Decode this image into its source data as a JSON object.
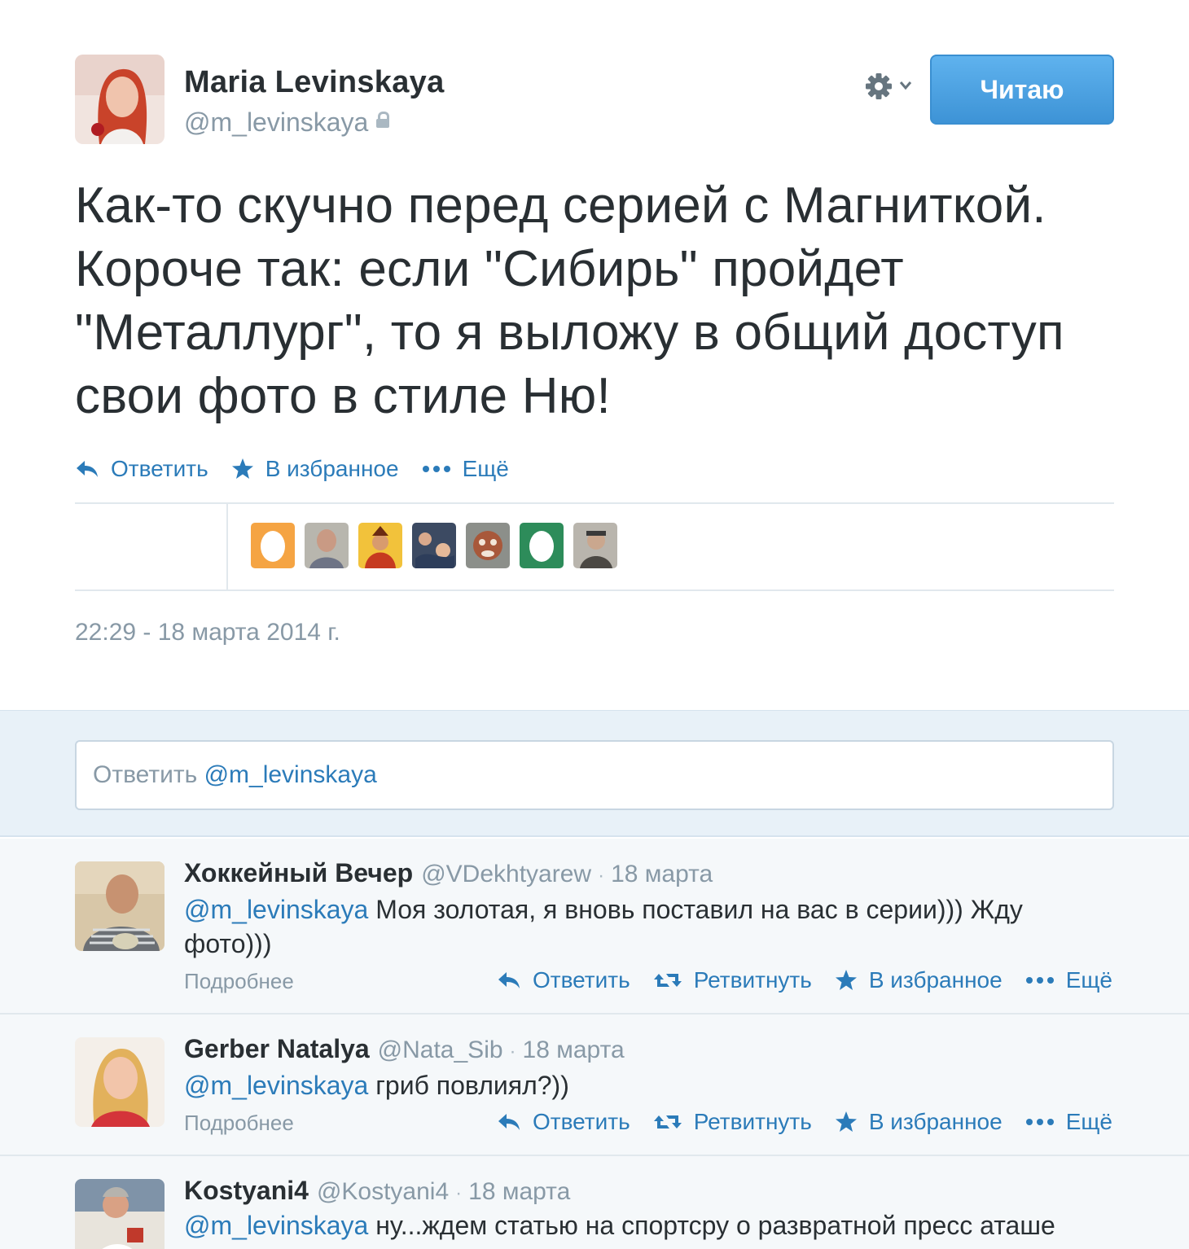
{
  "tweet": {
    "author_name": "Maria Levinskaya",
    "author_handle": "@m_levinskaya",
    "follow_label": "Читаю",
    "text": "Как-то скучно перед серией с Магниткой. Короче так: если \"Сибирь\" пройдет \"Металлург\", то я выложу в общий доступ свои фото в стиле Ню!",
    "actions": {
      "reply": "Ответить",
      "favorite": "В избранное",
      "more": "Ещё"
    },
    "timestamp": "22:29 - 18 марта 2014 г."
  },
  "reply_box": {
    "prefix": "Ответить",
    "mention": "@m_levinskaya"
  },
  "replies": [
    {
      "name": "Хоккейный Вечер",
      "handle": "@VDekhtyarew",
      "date": "18 марта",
      "mention": "@m_levinskaya",
      "text": " Моя золотая, я вновь поставил на вас в серии))) Жду фото)))",
      "details": "Подробнее",
      "actions": {
        "reply": "Ответить",
        "retweet": "Ретвитнуть",
        "favorite": "В избранное",
        "more": "Ещё"
      }
    },
    {
      "name": "Gerber Natalya",
      "handle": "@Nata_Sib",
      "date": "18 марта",
      "mention": "@m_levinskaya",
      "text": " гриб повлиял?))",
      "details": "Подробнее",
      "actions": {
        "reply": "Ответить",
        "retweet": "Ретвитнуть",
        "favorite": "В избранное",
        "more": "Ещё"
      }
    },
    {
      "name": "Kostyani4",
      "handle": "@Kostyani4",
      "date": "18 марта",
      "mention": "@m_levinskaya",
      "text": " ну...ждем статью на спортсру о развратной пресс аташе"
    }
  ],
  "colors": {
    "link": "#2b7bb9",
    "follow_button": "#4aa3e3",
    "reply_area_bg": "#e8f1f8",
    "muted": "#8899a6"
  }
}
